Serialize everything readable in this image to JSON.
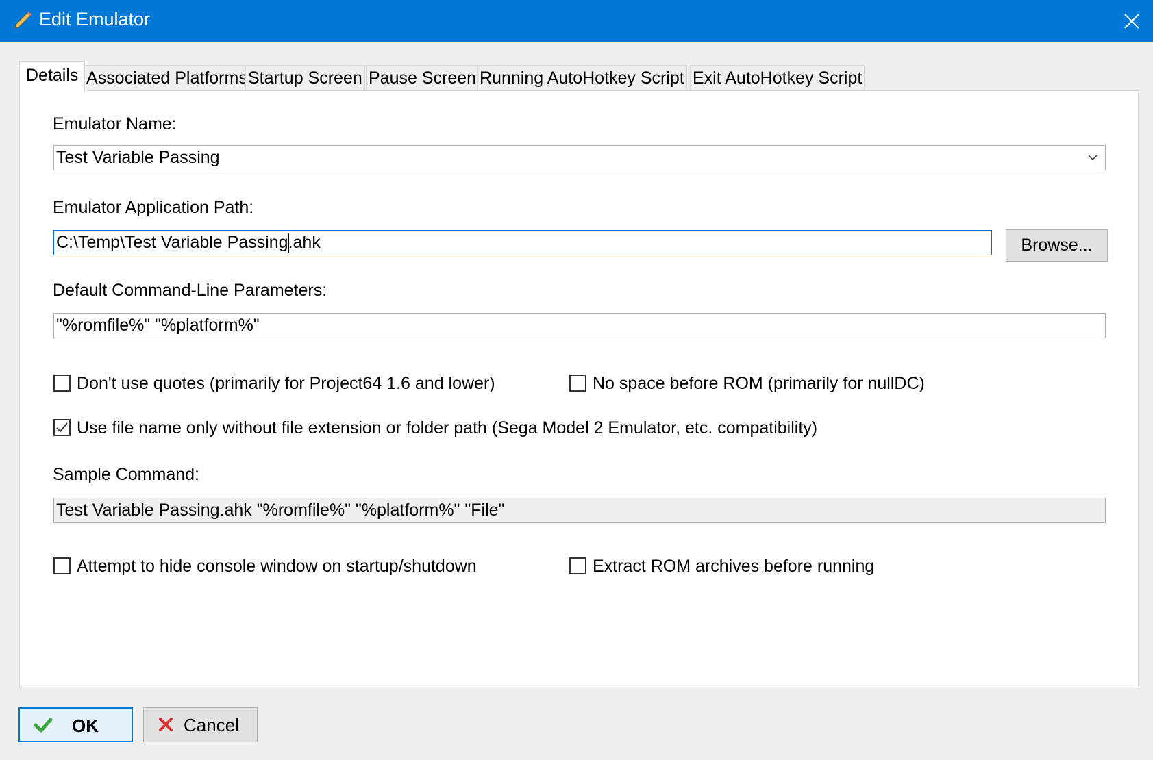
{
  "window": {
    "title": "Edit Emulator",
    "title_icon": "pencil-icon",
    "close_icon": "close-icon",
    "titlebar_color": "#0078d7"
  },
  "tabs": [
    {
      "label": "Details",
      "active": true
    },
    {
      "label": "Associated Platforms",
      "active": false
    },
    {
      "label": "Startup Screen",
      "active": false
    },
    {
      "label": "Pause Screen",
      "active": false
    },
    {
      "label": "Running AutoHotkey Script",
      "active": false
    },
    {
      "label": "Exit AutoHotkey Script",
      "active": false
    }
  ],
  "details": {
    "emulator_name_label": "Emulator Name:",
    "emulator_name_value": "Test Variable Passing",
    "app_path_label": "Emulator Application Path:",
    "app_path_value_before_caret": "C:\\Temp\\Test Variable Passing",
    "app_path_value_after_caret": ".ahk",
    "browse_label": "Browse...",
    "cmdline_label": "Default Command-Line Parameters:",
    "cmdline_value": "\"%romfile%\" \"%platform%\"",
    "no_quotes_label": "Don't use quotes (primarily for Project64 1.6 and lower)",
    "no_quotes_checked": false,
    "no_space_label": "No space before ROM (primarily for nullDC)",
    "no_space_checked": false,
    "filename_only_label": "Use file name only without file extension or folder path (Sega Model 2 Emulator, etc. compatibility)",
    "filename_only_checked": true,
    "sample_label": "Sample Command:",
    "sample_value": "Test Variable Passing.ahk \"%romfile%\" \"%platform%\" \"File\"",
    "hide_console_label": "Attempt to hide console window on startup/shutdown",
    "hide_console_checked": false,
    "extract_rom_label": "Extract ROM archives before running",
    "extract_rom_checked": false
  },
  "footer": {
    "ok_label": "OK",
    "ok_icon": "checkmark-icon",
    "cancel_label": "Cancel",
    "cancel_icon": "red-x-icon"
  }
}
